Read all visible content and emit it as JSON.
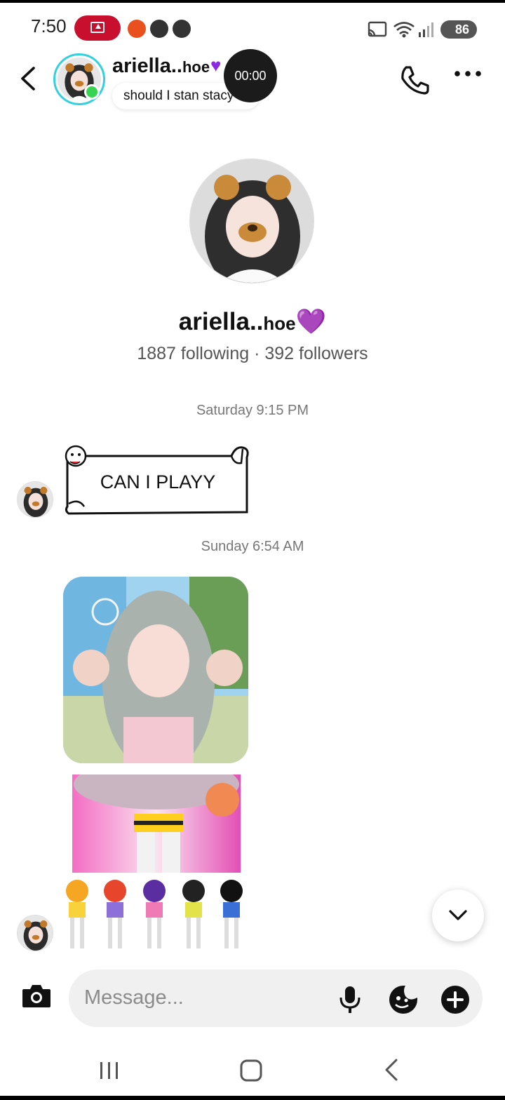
{
  "status_bar": {
    "time": "7:50",
    "battery": "86"
  },
  "header": {
    "name": "ariella..",
    "name_suffix": "hoe",
    "note": "should I stan stacy",
    "call_timer": "00:00"
  },
  "profile": {
    "name": "ariella..",
    "name_suffix": "hoe",
    "heart": "💜",
    "stats": "1887 following · 392 followers"
  },
  "conversation": {
    "stamp_1": "Saturday 9:15 PM",
    "sticker_text": "CAN I PLAYY",
    "stamp_2": "Sunday 6:54 AM"
  },
  "composer": {
    "placeholder": "Message..."
  },
  "colors": {
    "story_ring": "#33d1e0",
    "online": "#39d353",
    "record_pill": "#c8102e",
    "heart": "#8a2be2"
  }
}
